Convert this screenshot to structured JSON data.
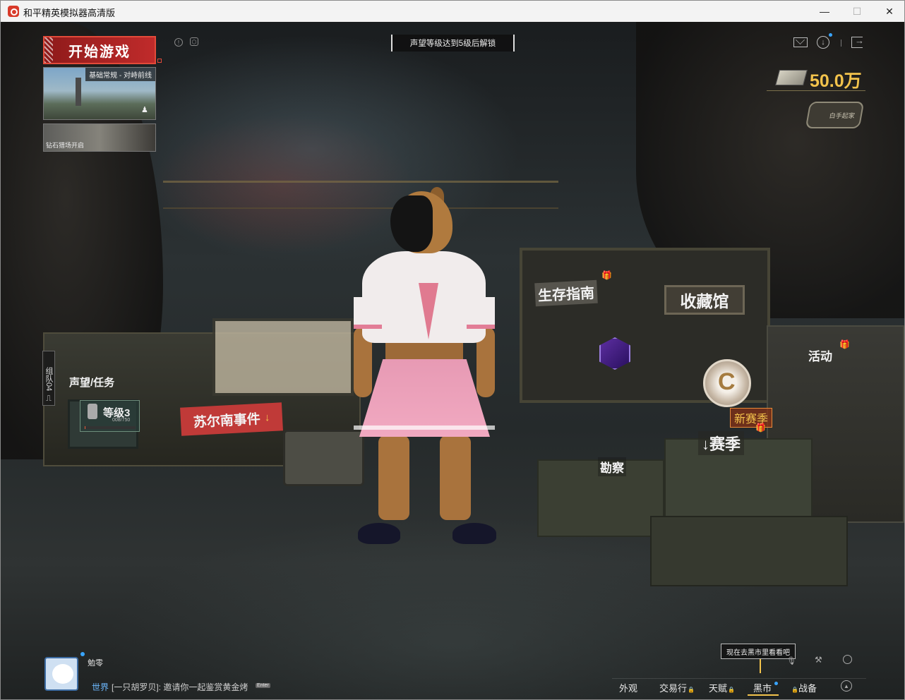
{
  "window": {
    "title": "和平精英模拟器高清版",
    "minimize": "—",
    "maximize": "☐",
    "close": "✕"
  },
  "lobby": {
    "start_game": "开始游戏",
    "mode": "基础常规 - 对峙前线",
    "rank": "钻石猎场开启",
    "notice": "声望等级达到5级后解锁",
    "currency": "50.0万",
    "badge": "白手起家",
    "team": "组队04"
  },
  "scene": {
    "survival_guide": "生存指南",
    "collection": "收藏馆",
    "activity": "活动",
    "reputation": "声望/任务",
    "level": "等级3",
    "level_progress_text": "008/750",
    "level_progress": 0.01,
    "suernan_event": "苏尔南事件",
    "survey": "勘察",
    "new_season": "新赛季",
    "season": "赛季"
  },
  "player": {
    "name": "勉零"
  },
  "chat": {
    "channel": "世界",
    "message": "[一只胡罗贝]: 邀请你一起鉴赏黄金烤",
    "enter": "Enter"
  },
  "tooltip": "现在去黑市里看看吧",
  "nav": {
    "appearance": "外观",
    "trade": "交易行",
    "talent": "天赋",
    "blackmarket": "黑市",
    "battlepass": "战备"
  },
  "icons": {
    "lock": "🔒",
    "gift": "🎁",
    "download": "↓"
  },
  "colors": {
    "accent_gold": "#f3c34c",
    "start_red": "#c02b2b",
    "dot_blue": "#39a5ff"
  }
}
